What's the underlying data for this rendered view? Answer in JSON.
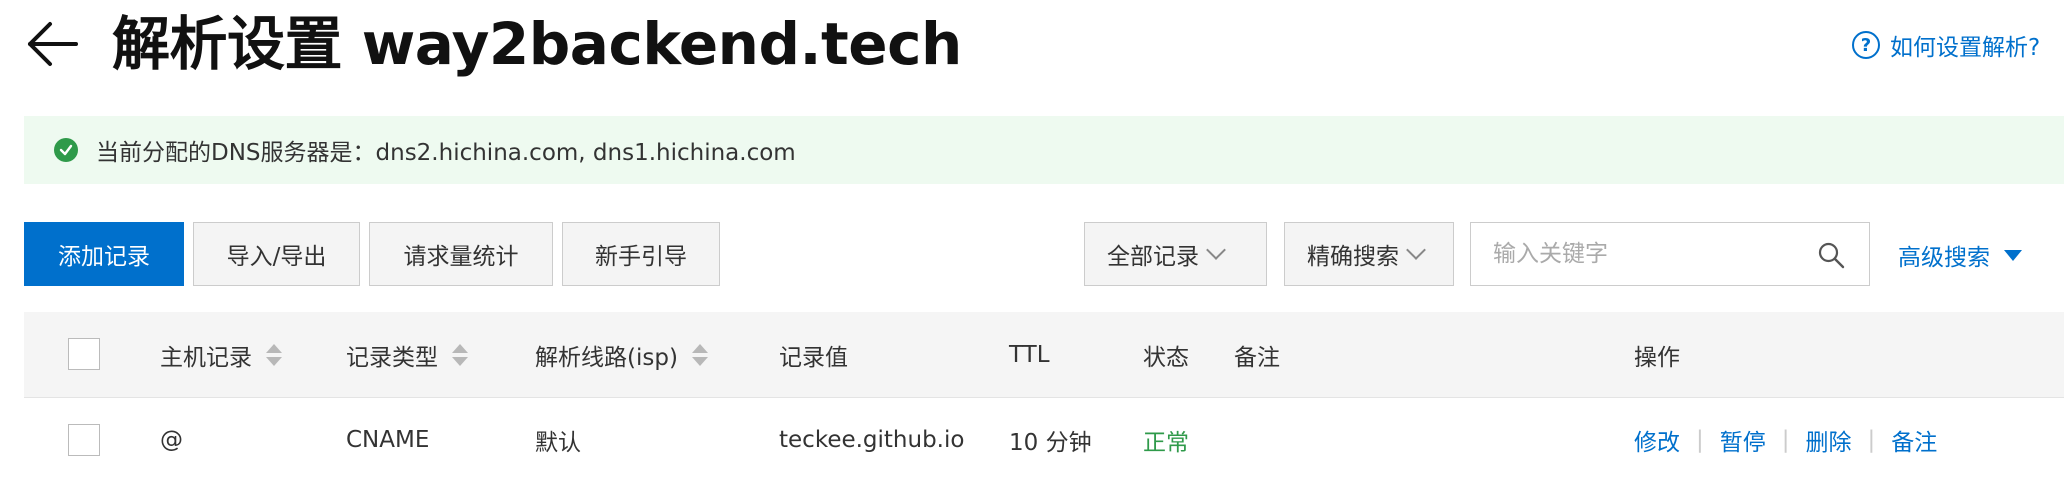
{
  "header": {
    "title": "解析设置 way2backend.tech",
    "help_icon": "?",
    "help_link": "如何设置解析?"
  },
  "notice": {
    "text": "当前分配的DNS服务器是：dns2.hichina.com, dns1.hichina.com",
    "icon": "check-circle-icon"
  },
  "toolbar": {
    "add_record": "添加记录",
    "import_export": "导入/导出",
    "request_stats": "请求量统计",
    "beginner_guide": "新手引导",
    "record_filter": "全部记录",
    "search_mode": "精确搜索",
    "search_placeholder": "输入关键字",
    "advanced_search": "高级搜索"
  },
  "table": {
    "columns": {
      "host": "主机记录",
      "type": "记录类型",
      "line": "解析线路(isp)",
      "value": "记录值",
      "ttl": "TTL",
      "status": "状态",
      "remark": "备注",
      "actions": "操作"
    },
    "rows": [
      {
        "host": "@",
        "type": "CNAME",
        "line": "默认",
        "value": "teckee.github.io",
        "ttl": "10 分钟",
        "status": "正常",
        "remark": "",
        "actions": [
          "修改",
          "暂停",
          "删除",
          "备注"
        ]
      }
    ]
  },
  "colors": {
    "accent": "#0070cc",
    "success": "#2f9a4a",
    "notice_bg": "#eefaf0"
  }
}
